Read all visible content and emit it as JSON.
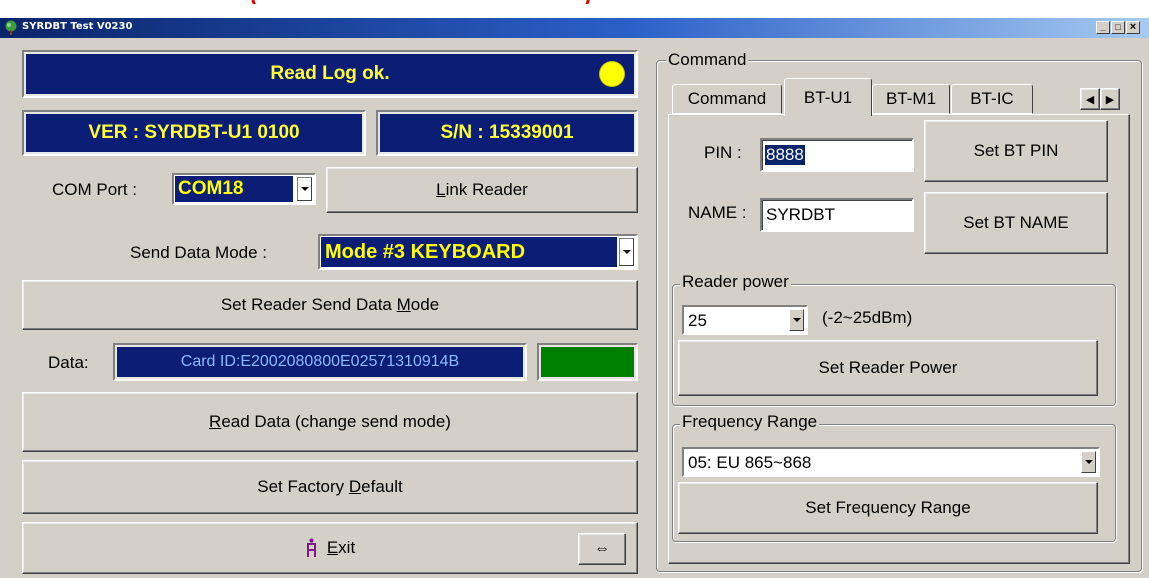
{
  "top_banner": "(                                        )",
  "window": {
    "title": "SYRDBT Test  V0230",
    "minimize": "_",
    "maximize": "□",
    "close": "×"
  },
  "left": {
    "status_text": "Read Log ok.",
    "status_led_color": "#ffff00",
    "version_text": "VER : SYRDBT-U1   0100",
    "serial_text": "S/N : 15339001",
    "com_port_label": "COM Port :",
    "com_port_value": "COM18",
    "link_reader_label": "Link Reader",
    "send_mode_label": "Send Data Mode :",
    "send_mode_value": "Mode #3 KEYBOARD",
    "set_send_mode_label": "Set Reader Send Data Mode",
    "data_label": "Data:",
    "data_value": "Card ID:E2002080800E02571310914B",
    "data_indicator_color": "#007f00",
    "read_data_label": "Read Data (change send mode)",
    "factory_default_label": "Set Factory Default",
    "exit_label": "Exit",
    "swap_glyph": "⇔"
  },
  "right": {
    "group_title": "Command",
    "tabs": [
      {
        "label": "Command",
        "active": false
      },
      {
        "label": "BT-U1",
        "active": true
      },
      {
        "label": "BT-M1",
        "active": false
      },
      {
        "label": "BT-IC",
        "active": false
      }
    ],
    "pin_label": "PIN :",
    "pin_value": "8888",
    "set_pin_label": "Set BT PIN",
    "name_label": "NAME :",
    "name_value": "SYRDBT",
    "set_name_label": "Set BT NAME",
    "power_group_title": "Reader power",
    "power_value": "25",
    "power_range": "(-2~25dBm)",
    "set_power_label": "Set Reader Power",
    "freq_group_title": "Frequency Range",
    "freq_value": "05: EU 865~868",
    "set_freq_label": "Set Frequency Range"
  }
}
